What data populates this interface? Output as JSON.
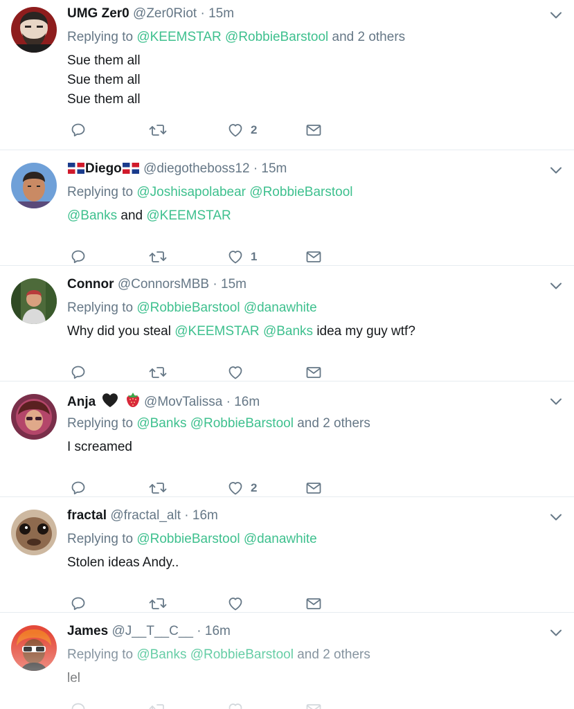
{
  "colors": {
    "accent": "#3ec08e",
    "muted": "#657786",
    "text": "#14171a",
    "divider": "#e6ecf0"
  },
  "tweets": [
    {
      "name": "UMG Zer0",
      "handle": "@Zer0Riot",
      "time": "15m",
      "replying_prefix": "Replying to",
      "replying_mentions": [
        "@KEEMSTAR",
        "@RobbieBarstool"
      ],
      "replying_suffix": "and 2 others",
      "body_lines": [
        "Sue them all",
        "Sue them all",
        "Sue them all"
      ],
      "likes": "2"
    },
    {
      "name": "Diego",
      "handle": "@diegotheboss12",
      "time": "15m",
      "replying_prefix": "Replying to",
      "replying_mentions": [
        "@Joshisapolabear",
        "@RobbieBarstool"
      ],
      "replying_line2_mention1": "@Banks",
      "replying_line2_and": "and",
      "replying_line2_mention2": "@KEEMSTAR",
      "likes": "1"
    },
    {
      "name": "Connor",
      "handle": "@ConnorsMBB",
      "time": "15m",
      "replying_prefix": "Replying to",
      "replying_mentions": [
        "@RobbieBarstool",
        "@danawhite"
      ],
      "body_pre": "Why did you steal",
      "body_mention1": "@KEEMSTAR",
      "body_mention2": "@Banks",
      "body_post": "idea my guy wtf?",
      "likes": ""
    },
    {
      "name": "Anja",
      "handle": "@MovTalissa",
      "time": "16m",
      "replying_prefix": "Replying to",
      "replying_mentions": [
        "@Banks",
        "@RobbieBarstool"
      ],
      "replying_suffix": "and 2 others",
      "body_lines": [
        "I screamed"
      ],
      "likes": "2"
    },
    {
      "name": "fractal",
      "handle": "@fractal_alt",
      "time": "16m",
      "replying_prefix": "Replying to",
      "replying_mentions": [
        "@RobbieBarstool",
        "@danawhite"
      ],
      "body_lines": [
        "Stolen ideas Andy.."
      ],
      "likes": ""
    },
    {
      "name": "James",
      "handle": "@J__T__C__",
      "time": "16m",
      "replying_prefix": "Replying to",
      "replying_mentions": [
        "@Banks",
        "@RobbieBarstool"
      ],
      "replying_suffix": "and 2 others",
      "body_lines": [
        "lel"
      ],
      "likes": ""
    }
  ],
  "separator": "·",
  "icons": {
    "reply": "reply-icon",
    "retweet": "retweet-icon",
    "like": "heart-icon",
    "dm": "envelope-icon",
    "more": "chevron-down-icon",
    "flag": "dominican-flag-icon",
    "heart_emoji": "black-heart-icon",
    "strawberry": "strawberry-icon"
  }
}
